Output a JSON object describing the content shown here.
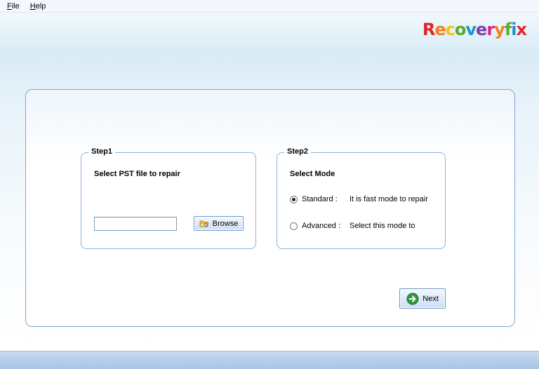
{
  "menu": {
    "items": [
      {
        "hotkey": "F",
        "rest": "ile"
      },
      {
        "hotkey": "H",
        "rest": "elp"
      }
    ]
  },
  "logo": {
    "letters": [
      "R",
      "e",
      "c",
      "o",
      "v",
      "e",
      "r",
      "y",
      "f",
      "i",
      "x"
    ],
    "colors": [
      "#e0262b",
      "#f2801f",
      "#f3c313",
      "#5aab2c",
      "#1e8fd0",
      "#7b3fa8",
      "#d7267b",
      "#f2801f",
      "#5aab2c",
      "#1e8fd0",
      "#e0262b"
    ]
  },
  "step1": {
    "legend": "Step1",
    "title": "Select PST file to repair",
    "file_value": "",
    "browse_label": "Browse"
  },
  "step2": {
    "legend": "Step2",
    "title": "Select Mode",
    "options": [
      {
        "label": "Standard :",
        "desc": "It is fast mode to repair",
        "checked": true
      },
      {
        "label": "Advanced :",
        "desc": "Select this mode to",
        "checked": false
      }
    ]
  },
  "next_label": "Next"
}
